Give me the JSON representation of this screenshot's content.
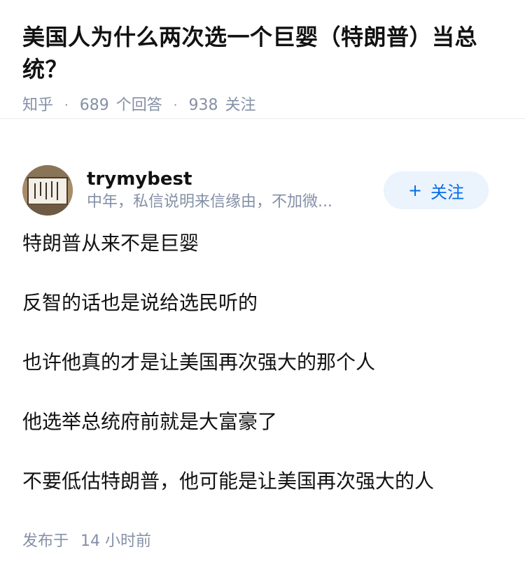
{
  "question": {
    "title": "美国人为什么两次选一个巨婴（特朗普）当总统？",
    "source": "知乎",
    "answer_count": "689",
    "answer_label": "个回答",
    "follower_count": "938",
    "follower_label": "关注"
  },
  "author": {
    "name": "trymybest",
    "bio": "中年，私信说明来信缘由，不加微...",
    "avatar": "calligraphy-avatar"
  },
  "follow_button": {
    "icon": "plus-icon",
    "label": "关注",
    "color": "#056de8",
    "background": "#ebf3fd"
  },
  "answer": {
    "paragraphs": [
      "特朗普从来不是巨婴",
      "反智的话也是说给选民听的",
      "也许他真的才是让美国再次强大的那个人",
      "他选举总统府前就是大富豪了",
      "不要低估特朗普，他可能是让美国再次强大的人"
    ],
    "publish_prefix": "发布于",
    "publish_time": "14 小时前"
  }
}
